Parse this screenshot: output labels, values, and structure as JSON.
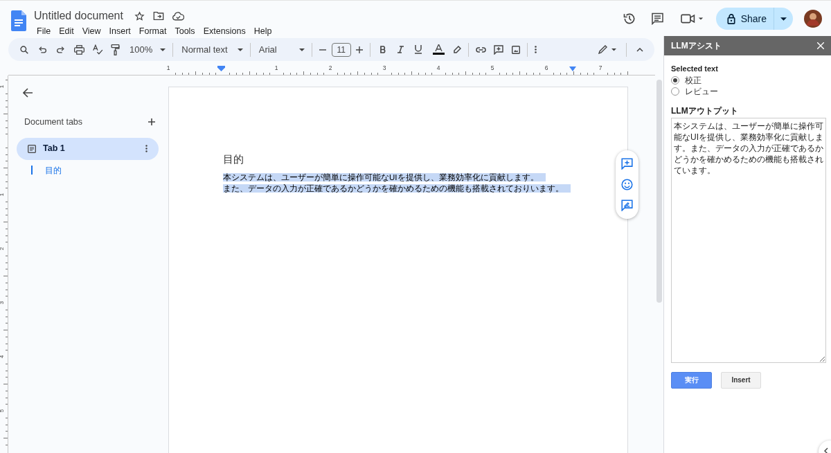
{
  "document": {
    "title": "Untitled document",
    "menu": [
      "File",
      "Edit",
      "View",
      "Insert",
      "Format",
      "Tools",
      "Extensions",
      "Help"
    ]
  },
  "header": {
    "share_label": "Share"
  },
  "toolbar": {
    "zoom": "100%",
    "style": "Normal text",
    "font": "Arial",
    "font_size": "11"
  },
  "ruler": {
    "horizontal": [
      "1",
      "1",
      "2",
      "3",
      "4",
      "5",
      "6",
      "7"
    ],
    "vertical": [
      "1",
      "1",
      "2",
      "3",
      "4",
      "5"
    ]
  },
  "tabs_sidebar": {
    "title": "Document tabs",
    "tabs": [
      {
        "label": "Tab 1",
        "selected": true,
        "children": [
          {
            "label": "目的"
          }
        ]
      }
    ]
  },
  "page": {
    "heading": "目的",
    "paragraph_lines": [
      "本システムは、ユーザーが簡単に操作可能なUIを提供し、業務効率化に貢献します。",
      "また、データの入力が正確であるかどうかを確かめるための機能も搭載されておりいます。"
    ],
    "text_selected": true
  },
  "side_panel": {
    "title": "LLMアシスト",
    "section_label": "Selected text",
    "options": [
      {
        "label": "校正",
        "selected": true
      },
      {
        "label": "レビュー",
        "selected": false
      }
    ],
    "output_label": "LLMアウトプット",
    "output_value": "本システムは、ユーザーが簡単に操作可能なUIを提供し、業務効率化に貢献します。また、データの入力が正確であるかどうかを確かめるための機能も搭載されています。",
    "buttons": [
      {
        "label": "実行",
        "kind": "primary"
      },
      {
        "label": "Insert",
        "kind": "secondary"
      }
    ]
  }
}
